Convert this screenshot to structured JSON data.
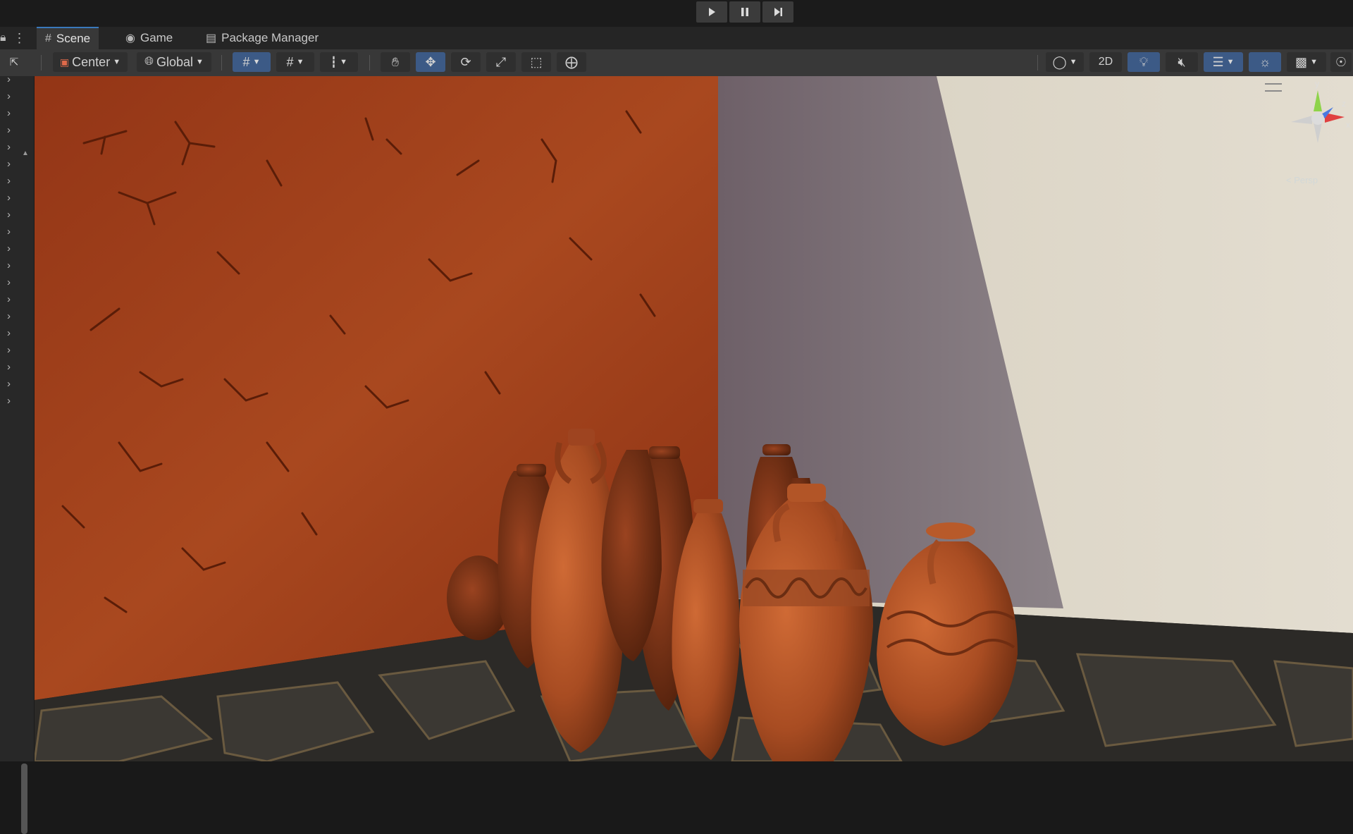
{
  "playbar": {
    "play": "play-icon",
    "pause": "pause-icon",
    "step": "step-icon"
  },
  "tabs": [
    {
      "label": "Scene",
      "icon": "grid-icon",
      "active": true
    },
    {
      "label": "Game",
      "icon": "gamepad-icon",
      "active": false
    },
    {
      "label": "Package Manager",
      "icon": "package-icon",
      "active": false
    }
  ],
  "toolbar": {
    "pivot_label": "Center",
    "space_label": "Global",
    "mode_2d_label": "2D"
  },
  "gizmo": {
    "y": "y",
    "x": "x",
    "z": "z",
    "persp": "< Persp"
  },
  "colors": {
    "accent": "#3a79bb",
    "wall_left": "#a8461f",
    "wall_right": "#ddd6c6",
    "pottery": "#b95a2a",
    "floor": "#2f2d2a"
  }
}
